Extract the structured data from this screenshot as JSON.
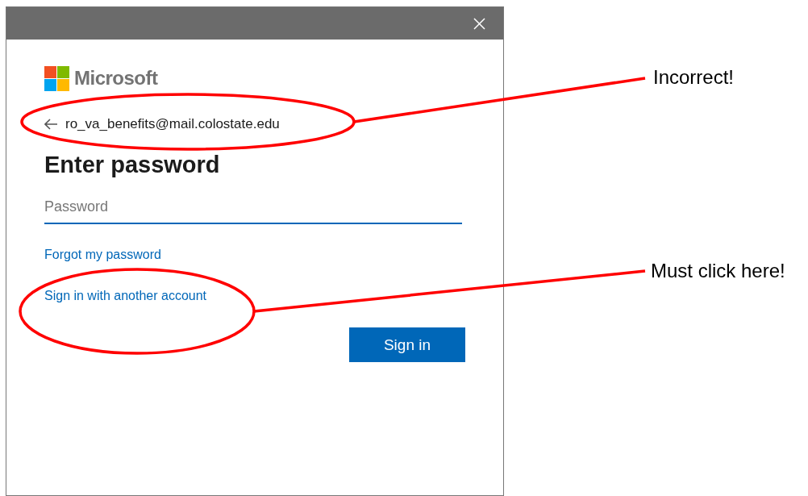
{
  "window": {
    "title_bar": {
      "close": true
    }
  },
  "logo": {
    "text": "Microsoft"
  },
  "identity": {
    "email": "ro_va_benefits@mail.colostate.edu"
  },
  "heading": "Enter password",
  "password_field": {
    "placeholder": "Password",
    "focused": true
  },
  "links": [
    {
      "label": "Forgot my password"
    },
    {
      "label": "Sign in with another account"
    }
  ],
  "buttons": [
    {
      "label": "Sign in",
      "kind": "primary"
    }
  ],
  "annotations": [
    {
      "text": "Incorrect!"
    },
    {
      "text": "Must click here!"
    }
  ]
}
